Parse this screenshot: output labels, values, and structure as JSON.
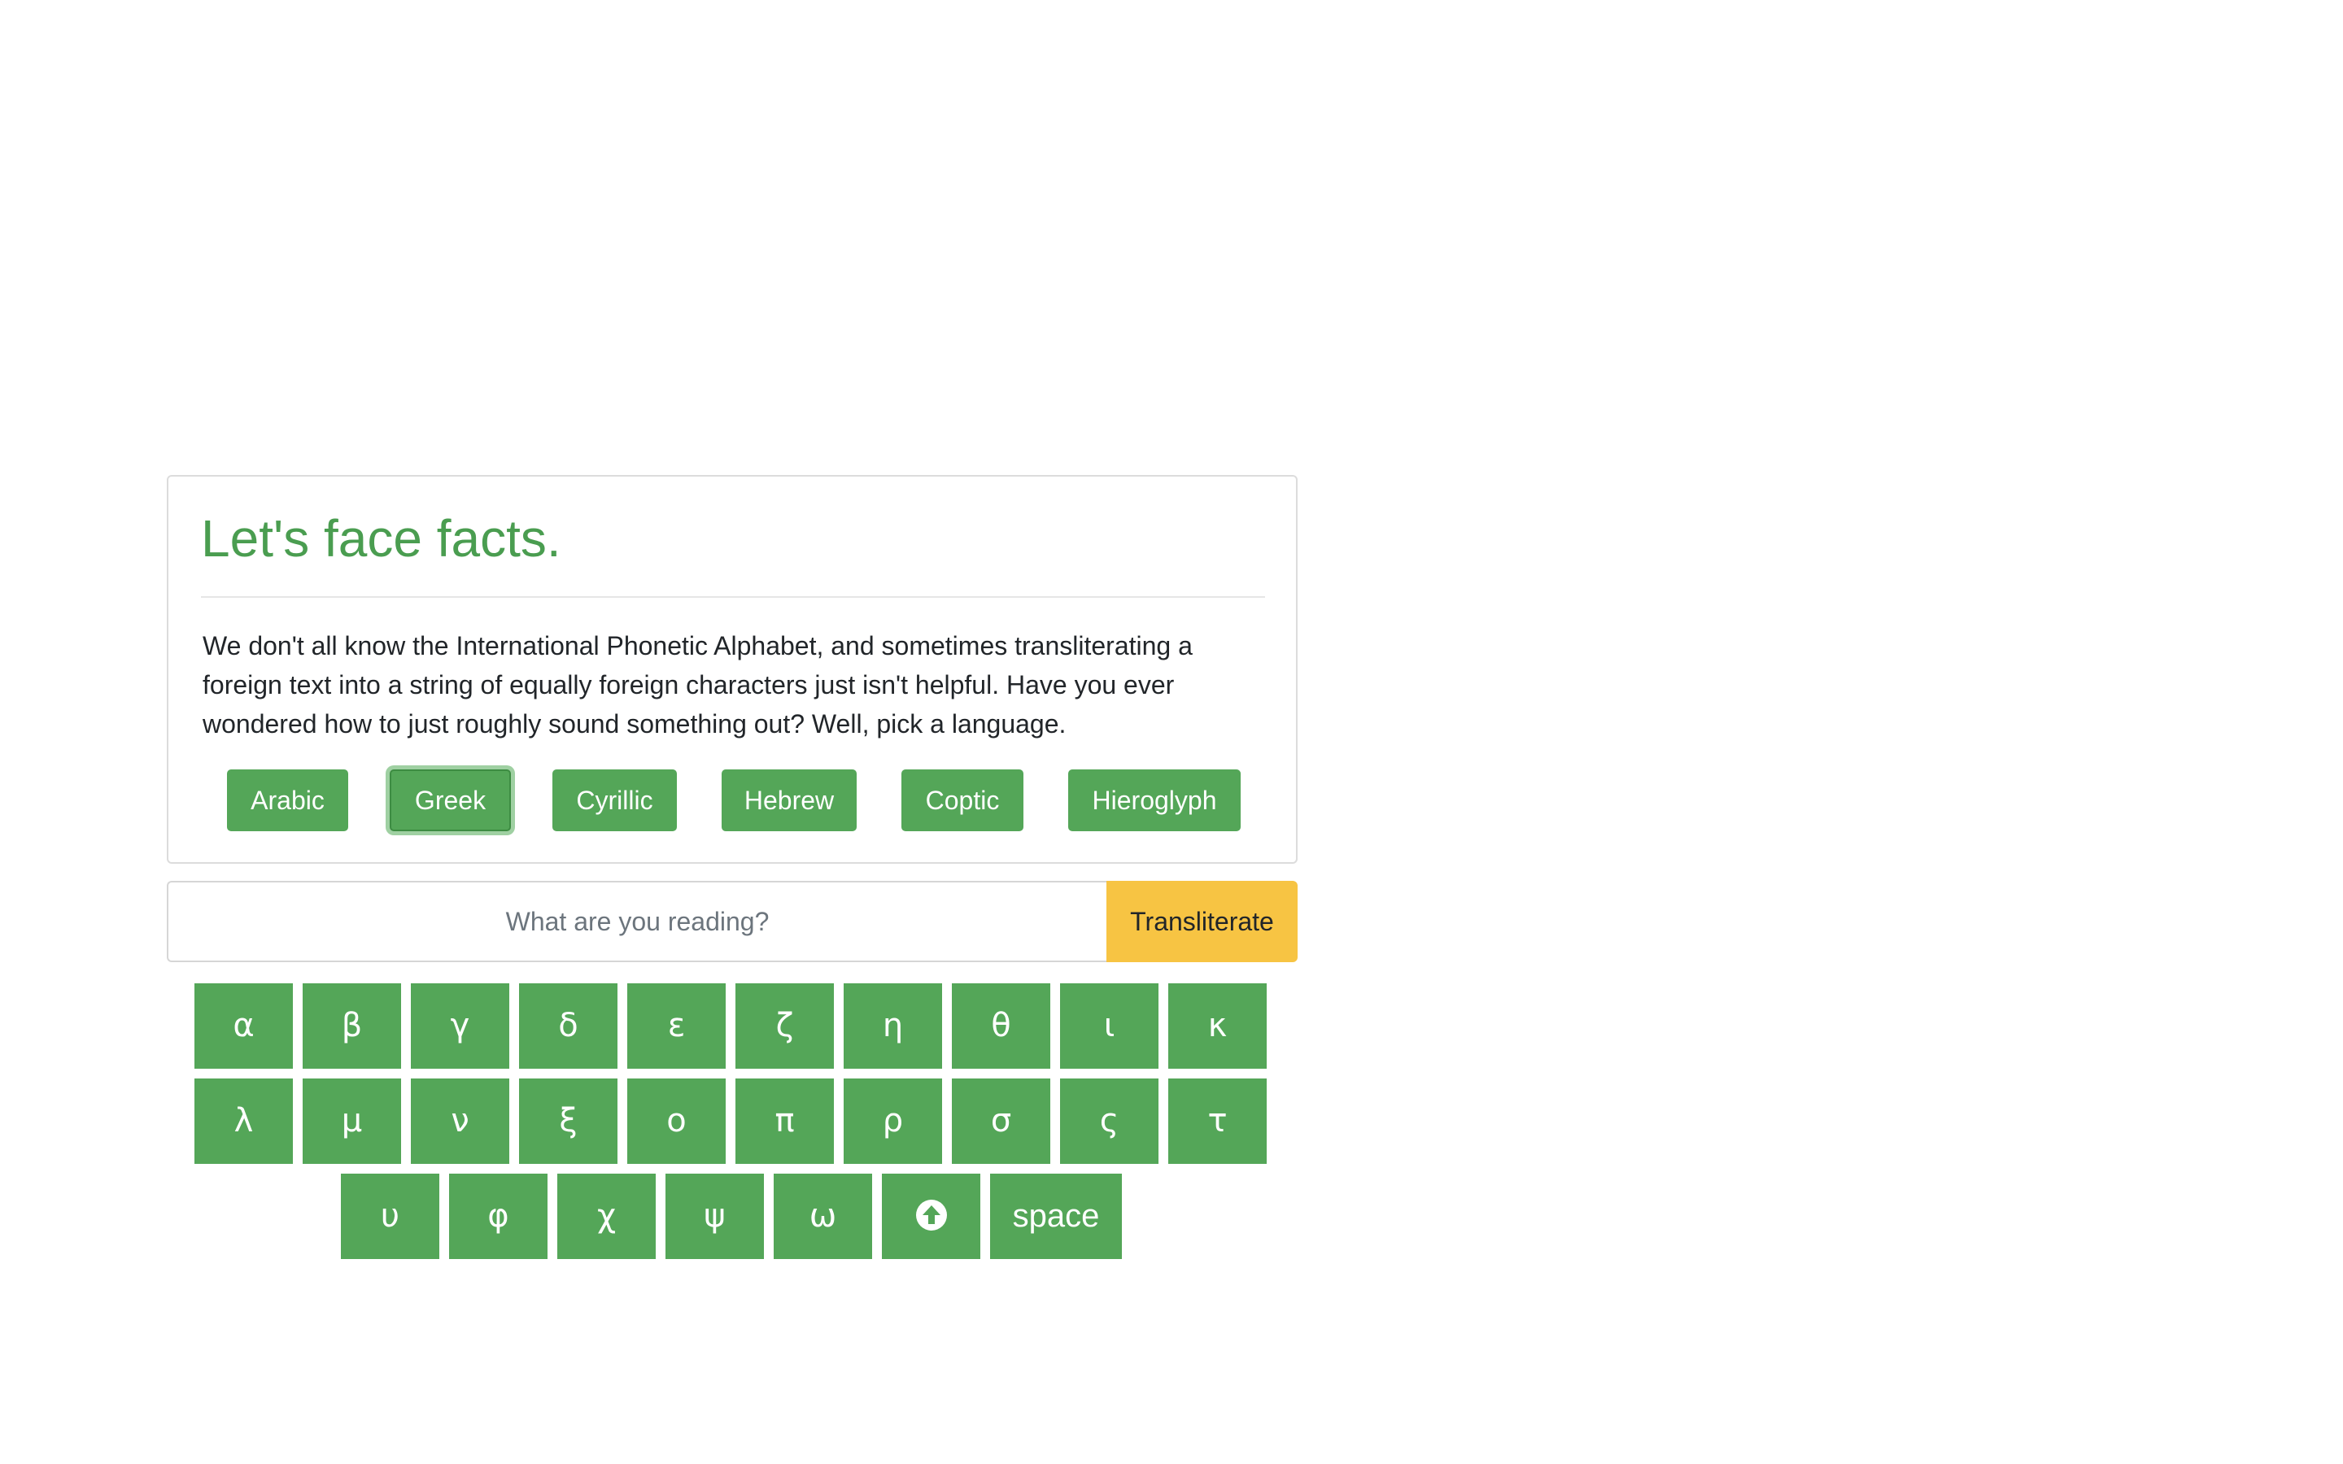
{
  "card": {
    "title": "Let's face facts.",
    "lead": "We don't all know the International Phonetic Alphabet, and sometimes transliterating a foreign text into a string of equally foreign characters just isn't helpful. Have you ever wondered how to just roughly sound something out? Well, pick a language.",
    "languages": [
      "Arabic",
      "Greek",
      "Cyrillic",
      "Hebrew",
      "Coptic",
      "Hieroglyph"
    ],
    "active_language": "Greek"
  },
  "search": {
    "placeholder": "What are you reading?",
    "value": "",
    "button_label": "Transliterate"
  },
  "keyboard": {
    "rows": [
      [
        "α",
        "β",
        "γ",
        "δ",
        "ε",
        "ζ",
        "η",
        "θ",
        "ι",
        "κ"
      ],
      [
        "λ",
        "μ",
        "ν",
        "ξ",
        "ο",
        "π",
        "ρ",
        "σ",
        "ς",
        "τ"
      ],
      [
        "υ",
        "φ",
        "χ",
        "ψ",
        "ω"
      ]
    ],
    "shift_icon": "arrow-up-circle-icon",
    "space_label": "space"
  },
  "colors": {
    "accent_green": "#54a658",
    "title_green": "#4a9d50",
    "button_yellow": "#f7c443"
  }
}
